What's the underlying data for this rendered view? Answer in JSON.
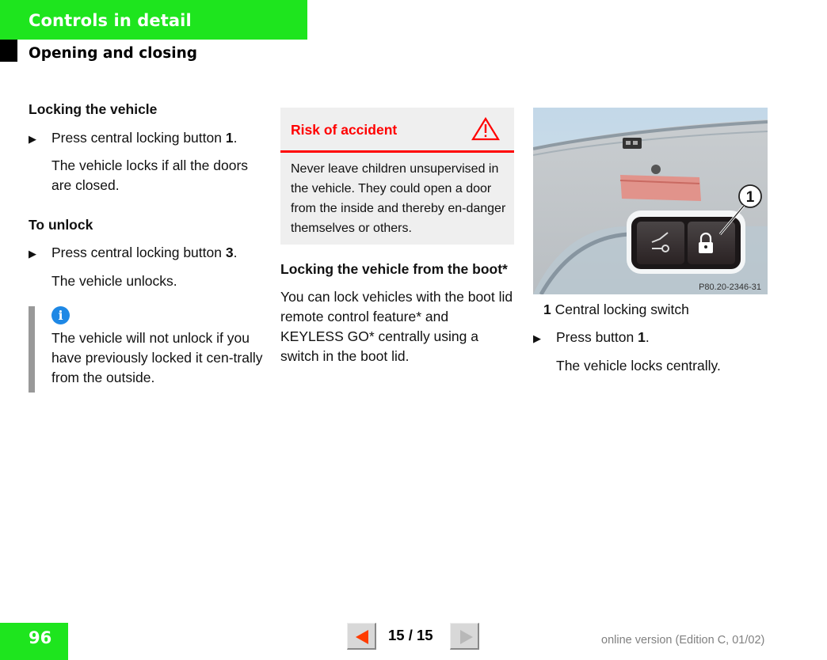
{
  "header": {
    "chapter": "Controls in detail",
    "section": "Opening and closing"
  },
  "column1": {
    "heading_lock": "Locking the vehicle",
    "lock_step_text": "Press central locking button",
    "lock_step_num": "1",
    "lock_result": "The vehicle locks if all the doors are closed.",
    "heading_unlock": "To unlock",
    "unlock_step_text": "Press central locking button",
    "unlock_step_num": "3",
    "unlock_result": "The vehicle unlocks.",
    "note_icon": "info-icon",
    "note_text": "The vehicle will not unlock if you have previously locked it cen-trally from the outside."
  },
  "warning": {
    "title": "Risk of accident",
    "icon": "warning-triangle-icon",
    "body": "Never leave children unsupervised in the vehicle. They could open a door from the inside and thereby en-danger themselves or others.",
    "accent_color": "#ff0000"
  },
  "column2": {
    "heading": "Locking the vehicle from the boot*",
    "paragraph": "You can lock vehicles with the boot lid remote control feature* and KEYLESS GO* centrally using a switch in the boot lid."
  },
  "figure": {
    "callout": "1",
    "code": "P80.20-2346-31"
  },
  "column3": {
    "legend_num": "1",
    "legend_text": "Central locking switch",
    "step_text": "Press button",
    "step_num": "1",
    "result": "The vehicle locks centrally."
  },
  "footer": {
    "page_number": "96",
    "page_counter": "15 / 15",
    "prev_icon": "triangle-left-icon",
    "next_icon": "triangle-right-icon",
    "edition": "online version (Edition C, 01/02)"
  },
  "colors": {
    "brand_green": "#1ee51e",
    "warning_red": "#ff0000",
    "info_blue": "#1e88e5"
  }
}
